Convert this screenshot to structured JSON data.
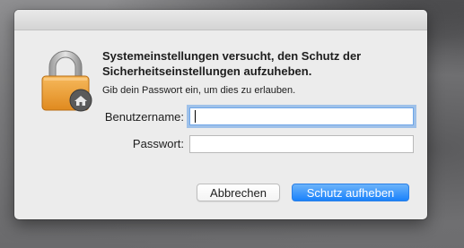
{
  "dialog": {
    "heading": "Systemeinstellungen versucht, den Schutz der Sicherheitseinstellungen aufzuheben.",
    "subtext": "Gib dein Passwort ein, um dies zu erlauben.",
    "icon": "padlock-icon"
  },
  "fields": {
    "username_label": "Benutzername:",
    "username_value": "",
    "password_label": "Passwort:",
    "password_value": ""
  },
  "buttons": {
    "cancel_label": "Abbrechen",
    "confirm_label": "Schutz aufheben"
  },
  "colors": {
    "accent": "#1a82fb",
    "focus_ring": "#6fa6e8",
    "dialog_bg": "#ececec"
  }
}
